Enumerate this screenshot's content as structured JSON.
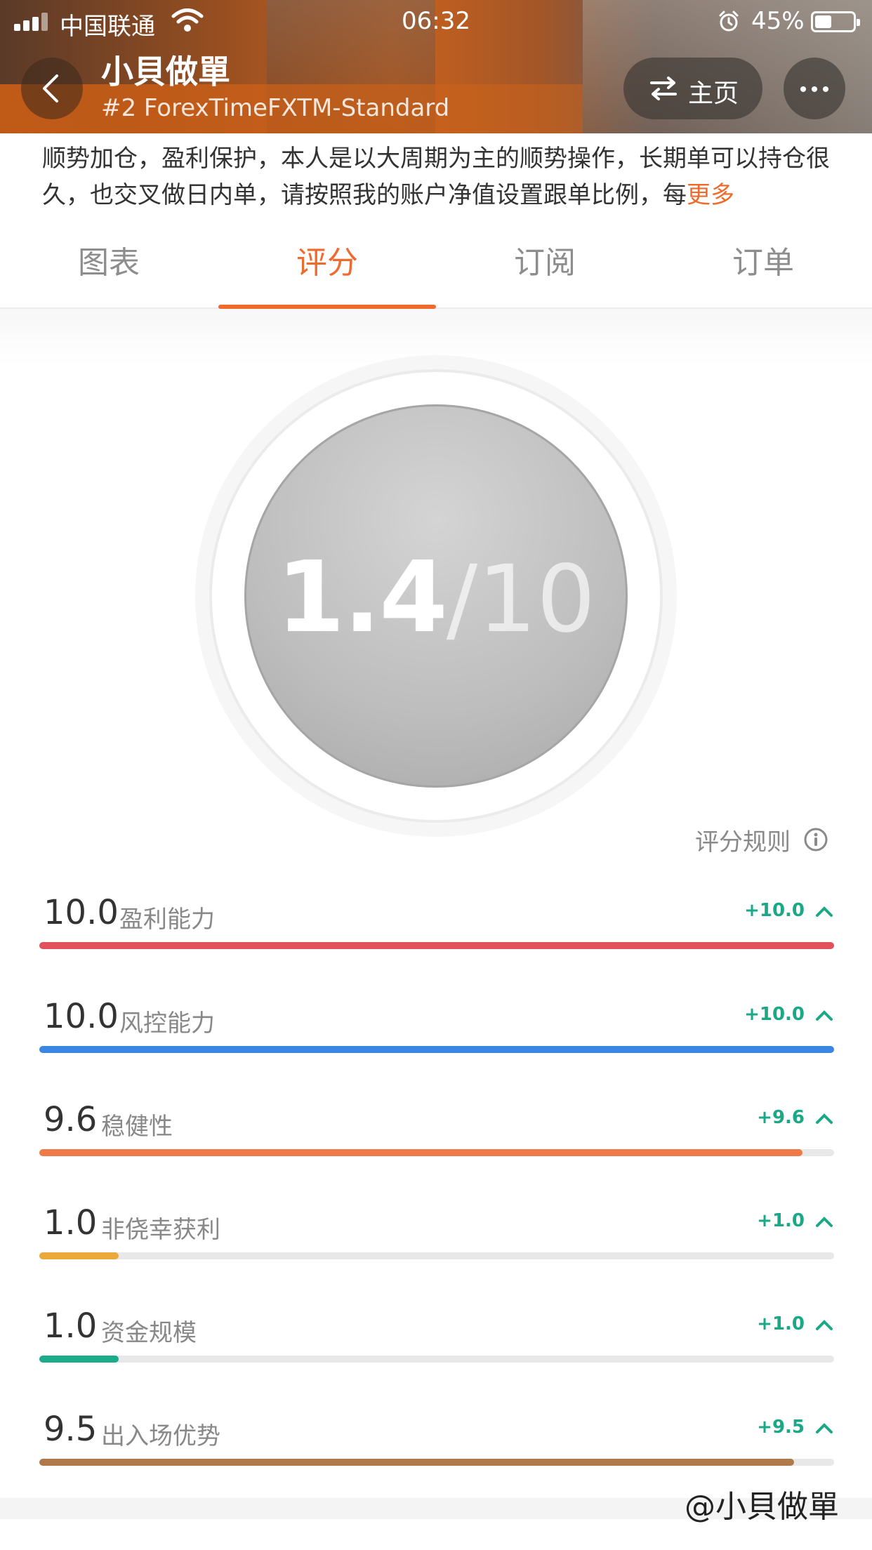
{
  "status_bar": {
    "carrier": "中国联通",
    "time": "06:32",
    "battery": "45%",
    "battery_level": 0.45
  },
  "header": {
    "title": "小貝做單",
    "subtitle": "#2 ForexTimeFXTM-Standard",
    "home_label": "主页"
  },
  "description": {
    "text": "顺势加仓，盈利保护，本人是以大周期为主的顺势操作，长期单可以持仓很久，也交叉做日内单，请按照我的账户净值设置跟单比例，每",
    "more": "更多"
  },
  "tabs": [
    "图表",
    "评分",
    "订阅",
    "订单"
  ],
  "active_tab": 1,
  "score": {
    "value": "1.4",
    "max": "/10"
  },
  "rules_label": "评分规则",
  "metrics": [
    {
      "value": "10.0",
      "label": "盈利能力",
      "delta": "+10.0",
      "level": 1.0,
      "color": "#e2525c"
    },
    {
      "value": "10.0",
      "label": "风控能力",
      "delta": "+10.0",
      "level": 1.0,
      "color": "#3a86e0"
    },
    {
      "value": "9.6",
      "label": "稳健性",
      "delta": "+9.6",
      "level": 0.96,
      "color": "#ef7a48"
    },
    {
      "value": "1.0",
      "label": "非侥幸获利",
      "delta": "+1.0",
      "level": 0.1,
      "color": "#eba93a"
    },
    {
      "value": "1.0",
      "label": "资金规模",
      "delta": "+1.0",
      "level": 0.1,
      "color": "#1bab8a"
    },
    {
      "value": "9.5",
      "label": "出入场优势",
      "delta": "+9.5",
      "level": 0.95,
      "color": "#b0794a"
    }
  ],
  "watermark": "@小貝做單"
}
